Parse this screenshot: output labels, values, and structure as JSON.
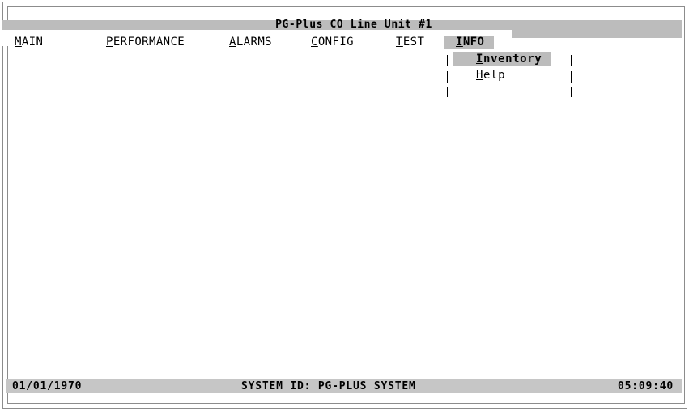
{
  "window": {
    "title": "PG-Plus CO Line Unit #1"
  },
  "menu": {
    "items": [
      {
        "hotkey": "M",
        "rest": "AIN"
      },
      {
        "hotkey": "P",
        "rest": "ERFORMANCE"
      },
      {
        "hotkey": "A",
        "rest": "LARMS"
      },
      {
        "hotkey": "C",
        "rest": "ONFIG"
      },
      {
        "hotkey": "T",
        "rest": "EST"
      },
      {
        "hotkey": "I",
        "rest": "NFO"
      }
    ],
    "active": "INFO"
  },
  "dropdown": {
    "items": [
      {
        "hotkey": "I",
        "rest": "nventory",
        "selected": true
      },
      {
        "hotkey": "H",
        "rest": "elp",
        "selected": false
      }
    ]
  },
  "status": {
    "date": "01/01/1970",
    "system_id": "SYSTEM ID: PG-PLUS SYSTEM",
    "time": "05:09:40"
  },
  "colors": {
    "highlight": "#bcbcbc",
    "status_bar": "#c6c6c6",
    "border": "#8c8c8c"
  }
}
